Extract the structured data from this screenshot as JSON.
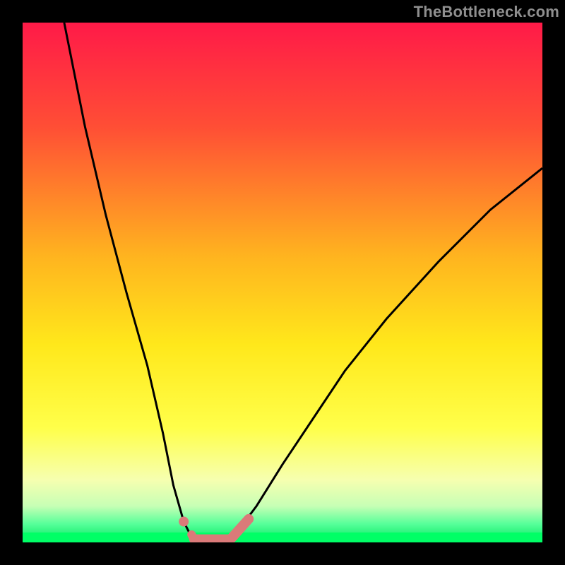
{
  "watermark": "TheBottleneck.com",
  "chart_data": {
    "type": "line",
    "title": "",
    "xlabel": "",
    "ylabel": "",
    "xlim": [
      0,
      100
    ],
    "ylim": [
      0,
      100
    ],
    "grid": false,
    "legend": false,
    "note": "No axis ticks or numeric labels are rendered; values are estimated from pixel positions of the curve.",
    "series": [
      {
        "name": "bottleneck-curve",
        "x": [
          8,
          12,
          16,
          20,
          24,
          27,
          29,
          31,
          32.5,
          34,
          36,
          38,
          40,
          42,
          45,
          50,
          56,
          62,
          70,
          80,
          90,
          100
        ],
        "y": [
          100,
          80,
          63,
          48,
          34,
          21,
          11,
          4,
          1,
          0,
          0,
          0,
          1,
          3,
          7,
          15,
          24,
          33,
          43,
          54,
          64,
          72
        ]
      }
    ],
    "flat_region": {
      "x_start": 33,
      "x_end": 40,
      "y": 0
    },
    "markers": [
      {
        "name": "left-marker",
        "x": 31,
        "y": 4,
        "color": "#db7a79",
        "size": 5
      }
    ],
    "colors": {
      "curve": "#000000",
      "marker_stroke": "#db7a79",
      "flat_band": "#00ff66",
      "gradient_stops": [
        {
          "offset": 0.0,
          "color": "#ff1a48"
        },
        {
          "offset": 0.2,
          "color": "#ff4e35"
        },
        {
          "offset": 0.45,
          "color": "#ffb41f"
        },
        {
          "offset": 0.62,
          "color": "#ffe81b"
        },
        {
          "offset": 0.78,
          "color": "#ffff4a"
        },
        {
          "offset": 0.88,
          "color": "#f6ffb0"
        },
        {
          "offset": 0.93,
          "color": "#c7ffb5"
        },
        {
          "offset": 0.965,
          "color": "#55ff99"
        },
        {
          "offset": 1.0,
          "color": "#00e85e"
        }
      ]
    }
  }
}
